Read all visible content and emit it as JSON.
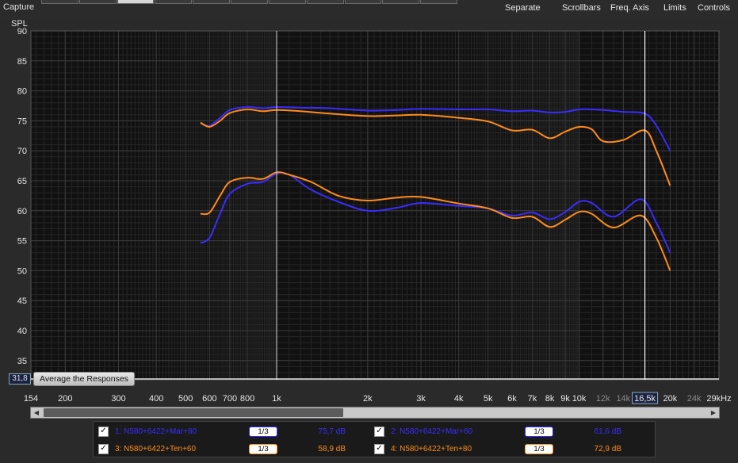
{
  "app": {
    "capture_label": "Capture",
    "menu": [
      {
        "id": "separate",
        "label": "Separate"
      },
      {
        "id": "scrollbars",
        "label": "Scrollbars"
      },
      {
        "id": "freq-axis",
        "label": "Freq. Axis"
      },
      {
        "id": "limits",
        "label": "Limits"
      },
      {
        "id": "controls",
        "label": "Controls"
      }
    ]
  },
  "chart_data": {
    "type": "line",
    "ylabel": "SPL",
    "xlabel": "",
    "x_scale": "log",
    "xlim": [
      154,
      29000
    ],
    "ylim": [
      31.8,
      90
    ],
    "y_ticks": [
      35,
      40,
      45,
      50,
      55,
      60,
      65,
      70,
      75,
      80,
      85,
      90
    ],
    "x_ticks": [
      {
        "v": 154,
        "label": "154"
      },
      {
        "v": 200,
        "label": "200"
      },
      {
        "v": 300,
        "label": "300"
      },
      {
        "v": 400,
        "label": "400"
      },
      {
        "v": 500,
        "label": "500"
      },
      {
        "v": 600,
        "label": "600"
      },
      {
        "v": 700,
        "label": "700"
      },
      {
        "v": 800,
        "label": "800"
      },
      {
        "v": 1000,
        "label": "1k"
      },
      {
        "v": 2000,
        "label": "2k"
      },
      {
        "v": 3000,
        "label": "3k"
      },
      {
        "v": 4000,
        "label": "4k"
      },
      {
        "v": 5000,
        "label": "5k"
      },
      {
        "v": 6000,
        "label": "6k"
      },
      {
        "v": 7000,
        "label": "7k"
      },
      {
        "v": 8000,
        "label": "8k"
      },
      {
        "v": 9000,
        "label": "9k"
      },
      {
        "v": 10000,
        "label": "10k"
      },
      {
        "v": 12000,
        "label": "12k"
      },
      {
        "v": 14000,
        "label": "14k"
      },
      {
        "v": 16500,
        "label": "16,5k"
      },
      {
        "v": 20000,
        "label": "20k"
      },
      {
        "v": 24000,
        "label": "24k"
      },
      {
        "v": 29000,
        "label": "29kHz"
      }
    ],
    "dim_tick_labels": [
      "12k",
      "14k",
      "24k"
    ],
    "cursor_x": 16500,
    "cursor_x_label": "16,5k",
    "cursor_y_label": "31,8",
    "marker_x": 1000,
    "series": [
      {
        "name": "1: N580+6422+Mar+80",
        "color": "#3a2cff",
        "x": [
          560,
          600,
          650,
          700,
          800,
          900,
          1000,
          1200,
          1500,
          2000,
          2500,
          3000,
          4000,
          5000,
          6000,
          7000,
          8000,
          9000,
          10000,
          11000,
          12000,
          14000,
          16500,
          18000,
          20000
        ],
        "y": [
          74.6,
          74.2,
          75.5,
          76.8,
          77.3,
          77.1,
          77.3,
          77.2,
          77.1,
          76.7,
          76.8,
          77.0,
          76.9,
          76.9,
          76.6,
          76.7,
          76.4,
          76.5,
          76.9,
          76.9,
          76.8,
          76.5,
          76.2,
          74.2,
          70.0
        ]
      },
      {
        "name": "2: N580+6422+Mar+60",
        "color": "#3a2cff",
        "x": [
          560,
          600,
          650,
          700,
          800,
          900,
          1000,
          1100,
          1300,
          1600,
          2000,
          2500,
          3000,
          4000,
          5000,
          6000,
          7000,
          8000,
          9000,
          10000,
          11000,
          13000,
          16000,
          18000,
          20000
        ],
        "y": [
          54.6,
          55.5,
          59.5,
          62.8,
          64.5,
          64.8,
          66.2,
          66.0,
          63.5,
          61.5,
          60.0,
          60.5,
          61.3,
          60.8,
          60.4,
          59.2,
          59.7,
          58.6,
          59.8,
          61.5,
          61.3,
          59.0,
          61.9,
          58.0,
          53.0
        ]
      },
      {
        "name": "3: N580+6422+Ten+60",
        "color": "#ff8c1a",
        "x": [
          560,
          600,
          650,
          700,
          800,
          900,
          1000,
          1100,
          1300,
          1600,
          2000,
          2500,
          3000,
          4000,
          5000,
          6000,
          7000,
          8000,
          9000,
          10000,
          11000,
          13000,
          16000,
          18000,
          20000
        ],
        "y": [
          59.5,
          59.7,
          62.5,
          64.8,
          65.5,
          65.3,
          66.4,
          66.0,
          64.8,
          62.5,
          61.7,
          62.2,
          62.3,
          61.2,
          60.4,
          58.8,
          59.0,
          57.3,
          58.5,
          59.8,
          59.5,
          57.2,
          59.2,
          55.5,
          50.0
        ]
      },
      {
        "name": "4: N580+6422+Ten+80",
        "color": "#ff8c1a",
        "x": [
          560,
          600,
          650,
          700,
          800,
          900,
          1000,
          1200,
          1500,
          2000,
          2500,
          3000,
          4000,
          5000,
          6000,
          7000,
          8000,
          9000,
          10000,
          11000,
          12000,
          14000,
          16500,
          18000,
          20000
        ],
        "y": [
          74.7,
          74.0,
          75.0,
          76.3,
          76.9,
          76.6,
          76.8,
          76.6,
          76.2,
          75.8,
          75.9,
          76.0,
          75.5,
          74.9,
          73.4,
          73.5,
          72.1,
          73.2,
          74.0,
          73.6,
          71.6,
          71.8,
          73.4,
          70.0,
          64.2
        ]
      }
    ],
    "grid": true,
    "background": "#111111"
  },
  "toolbar": {
    "average_label": "Average the Responses"
  },
  "legend": {
    "entries": [
      {
        "name": "1: N580+6422+Mar+80",
        "smoothing": "1/3",
        "value": "75,7 dB",
        "color": "#3a2cff",
        "checked": true
      },
      {
        "name": "2: N580+6422+Mar+60",
        "smoothing": "1/3",
        "value": "61,6 dB",
        "color": "#3a2cff",
        "checked": true
      },
      {
        "name": "3: N580+6422+Ten+60",
        "smoothing": "1/3",
        "value": "58,9 dB",
        "color": "#ff8c1a",
        "checked": true
      },
      {
        "name": "4: N580+6422+Ten+80",
        "smoothing": "1/3",
        "value": "72,9 dB",
        "color": "#ff8c1a",
        "checked": true
      }
    ]
  }
}
